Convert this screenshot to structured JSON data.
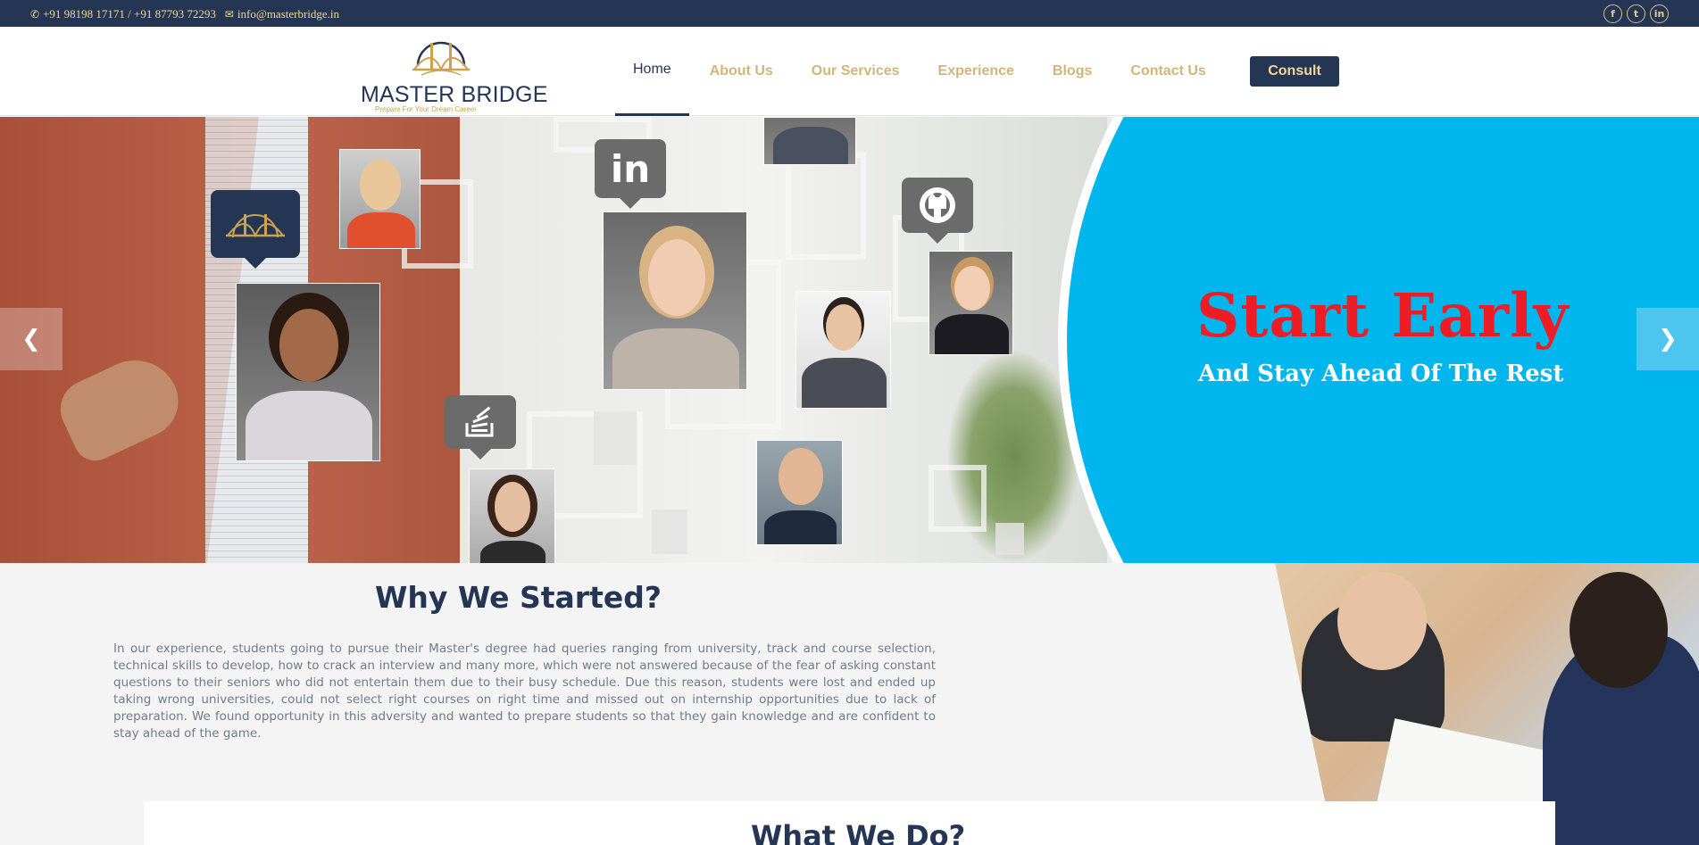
{
  "topbar": {
    "phone_icon": "phone-icon",
    "phones": "+91 98198 17171 / +91 87793 72293",
    "email_icon": "envelope-icon",
    "email": "info@masterbridge.in",
    "social": [
      {
        "name": "facebook-icon",
        "glyph": "f"
      },
      {
        "name": "twitter-icon",
        "glyph": "t"
      },
      {
        "name": "linkedin-icon",
        "glyph": "in"
      }
    ]
  },
  "header": {
    "logo_word1": "MASTER",
    "logo_word2": "BRIDGE",
    "logo_tagline": "Prepare For Your Dream Career",
    "nav": [
      {
        "label": "Home",
        "active": true
      },
      {
        "label": "About Us",
        "active": false
      },
      {
        "label": "Our Services",
        "active": false
      },
      {
        "label": "Experience",
        "active": false
      },
      {
        "label": "Blogs",
        "active": false
      },
      {
        "label": "Contact Us",
        "active": false
      }
    ],
    "consult_label": "Consult"
  },
  "hero": {
    "headline": "Start Early",
    "subheadline": "And Stay Ahead Of The Rest",
    "prev_icon": "chevron-left-icon",
    "next_icon": "chevron-right-icon",
    "badges": [
      "linkedin-icon",
      "github-icon",
      "stackoverflow-icon",
      "masterbridge-logo-icon"
    ]
  },
  "why": {
    "title": "Why We Started?",
    "text": "In our experience, students going to pursue their Master's degree had queries ranging from university, track and course selection, technical skills to develop, how to crack an interview and many more, which were not answered because of the fear of asking constant questions to their seniors who did not entertain them due to their busy schedule. Due this reason, students were lost and ended up taking wrong universities, could not select right courses on right time and missed out on internship opportunities due to lack of preparation. We found opportunity in this adversity and wanted to prepare students so that they gain knowledge and are confident to stay ahead of the game."
  },
  "what": {
    "title": "What We Do?"
  },
  "colors": {
    "navy": "#253655",
    "gold": "#d3b57a",
    "hero_blue": "#00b6ec",
    "headline_red": "#ee1c24"
  }
}
